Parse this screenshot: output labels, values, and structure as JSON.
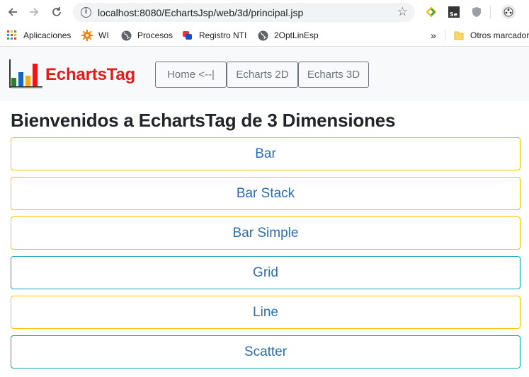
{
  "browser": {
    "url": "localhost:8080/EchartsJsp/web/3d/principal.jsp",
    "bookmarks": [
      {
        "label": "Aplicaciones",
        "icon": "apps-grid-icon"
      },
      {
        "label": "WI",
        "icon": "gear-icon"
      },
      {
        "label": "Procesos",
        "icon": "globe-icon"
      },
      {
        "label": "Registro NTI",
        "icon": "registro-icon"
      },
      {
        "label": "2OptLinEsp",
        "icon": "globe-icon"
      }
    ],
    "overflow": "»",
    "other_bookmarks": "Otros marcador"
  },
  "navbar": {
    "brand": "EchartsTag",
    "links": [
      "Home <--|",
      "Echarts 2D",
      "Echarts 3D"
    ]
  },
  "page": {
    "heading": "Bienvenidos a EchartsTag de 3 Dimensiones",
    "options": [
      {
        "label": "Bar",
        "style": "warning",
        "color": "#ffc107"
      },
      {
        "label": "Bar Stack",
        "style": "warning",
        "color": "#ffc107"
      },
      {
        "label": "Bar Simple",
        "style": "warning",
        "color": "#ffc107"
      },
      {
        "label": "Grid",
        "style": "info",
        "color": "#17a2b8"
      },
      {
        "label": "Line",
        "style": "warning",
        "color": "#ffc107"
      },
      {
        "label": "Scatter",
        "style": "info",
        "color": "#17a2b8"
      }
    ]
  },
  "colors": {
    "brand_red": "#e31b1b",
    "link_text": "#2a6db5",
    "warning_border": "#ffc107",
    "info_border": "#17a2b8"
  }
}
